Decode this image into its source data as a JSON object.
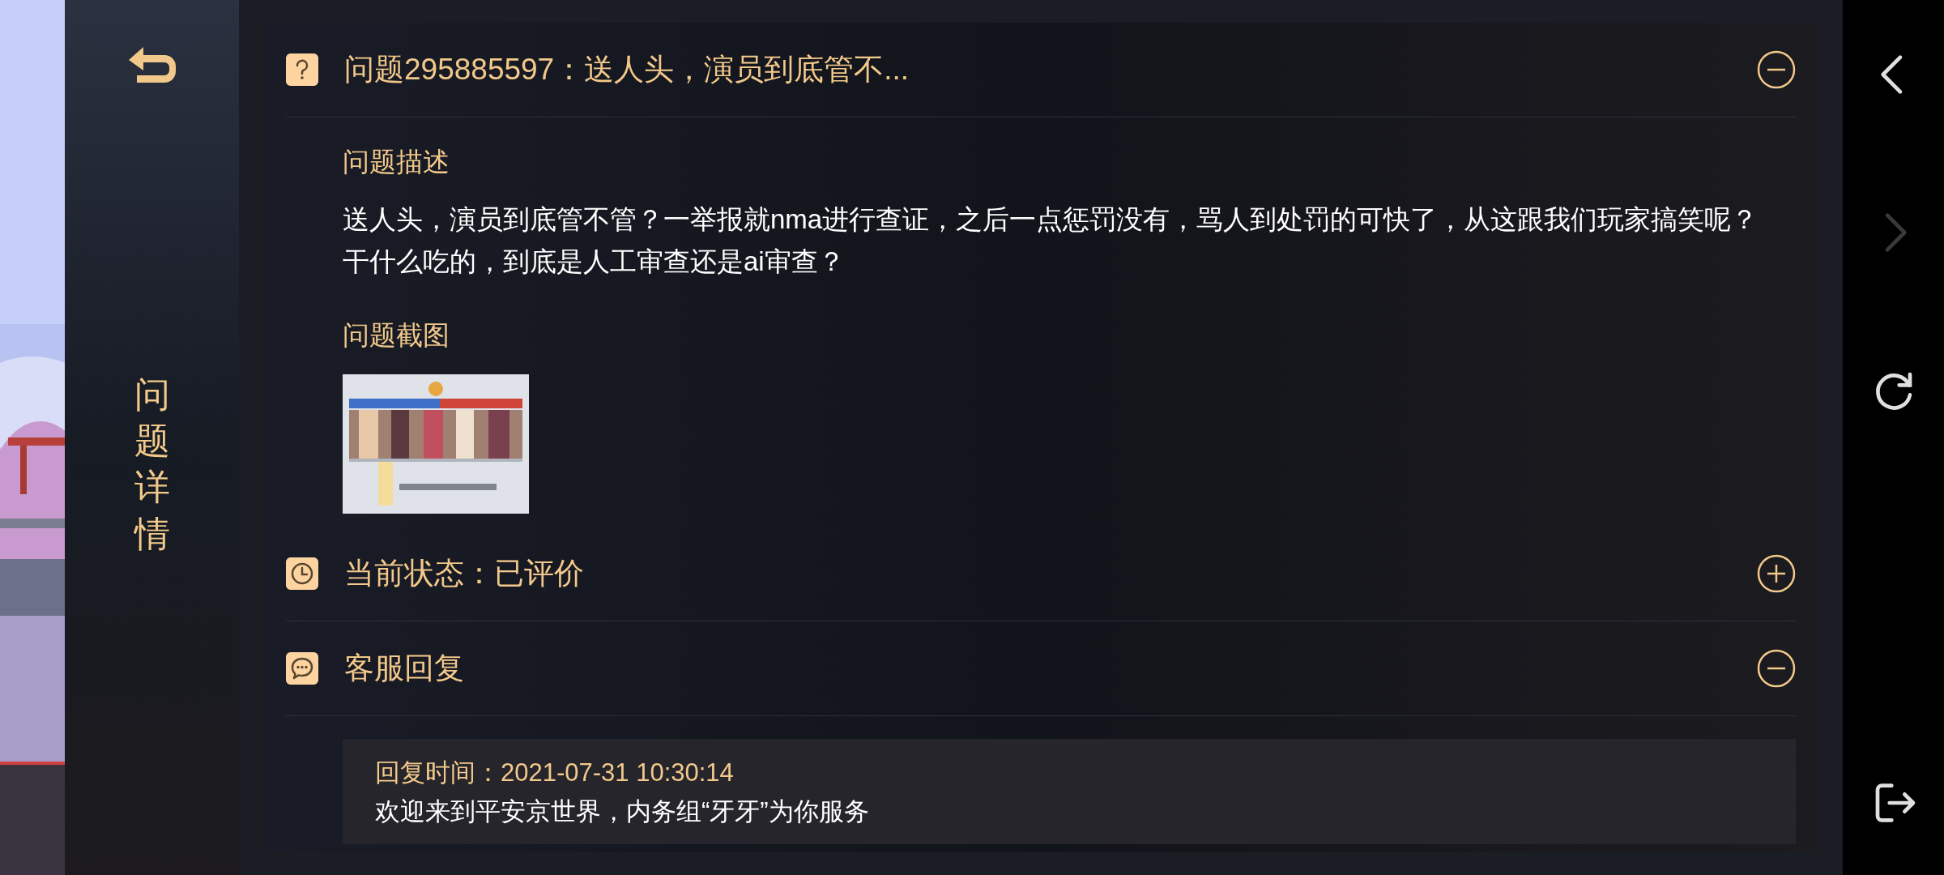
{
  "sidebar": {
    "title": "问题详情"
  },
  "sections": [
    {
      "kind": "question",
      "title": "问题295885597：送人头，演员到底管不...",
      "expanded": true,
      "description_label": "问题描述",
      "description": "送人头，演员到底管不管？一举报就nma进行查证，之后一点惩罚没有，骂人到处罚的可快了，从这跟我们玩家搞笑呢？干什么吃的，到底是人工审查还是ai审查？",
      "screenshot_label": "问题截图"
    },
    {
      "kind": "status",
      "title": "当前状态：已评价",
      "expanded": false
    },
    {
      "kind": "reply",
      "title": "客服回复",
      "expanded": true,
      "reply_time": "回复时间：2021-07-31 10:30:14",
      "reply_text": "欢迎来到平安京世界，内务组“牙牙”为你服务"
    }
  ],
  "nav": [
    {
      "kind": "back",
      "disabled": false
    },
    {
      "kind": "forward",
      "disabled": true
    },
    {
      "kind": "refresh",
      "disabled": false
    },
    {
      "kind": "exit",
      "disabled": false
    }
  ]
}
